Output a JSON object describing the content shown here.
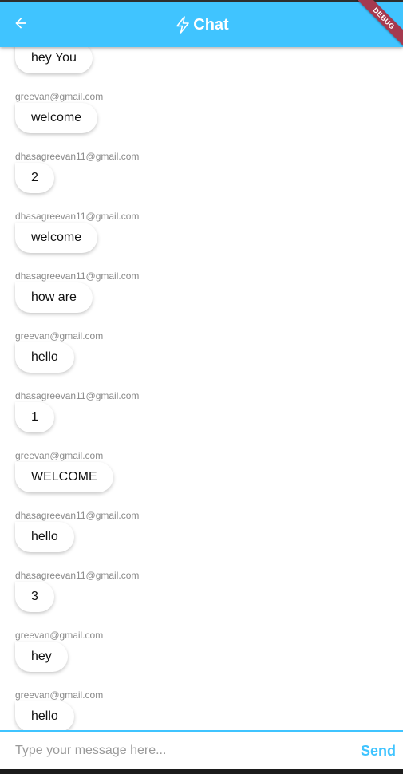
{
  "app_bar": {
    "title": "Chat",
    "back_icon": "arrow-left-icon",
    "title_icon": "lightning-bolt-icon",
    "color": "#40c4ff"
  },
  "debug_banner": "DEBUG",
  "messages": [
    {
      "sender": "",
      "text": "hey You"
    },
    {
      "sender": "greevan@gmail.com",
      "text": "welcome"
    },
    {
      "sender": "dhasagreevan11@gmail.com",
      "text": "2"
    },
    {
      "sender": "dhasagreevan11@gmail.com",
      "text": "welcome"
    },
    {
      "sender": "dhasagreevan11@gmail.com",
      "text": "how are"
    },
    {
      "sender": "greevan@gmail.com",
      "text": "hello"
    },
    {
      "sender": "dhasagreevan11@gmail.com",
      "text": "1"
    },
    {
      "sender": "greevan@gmail.com",
      "text": "WELCOME"
    },
    {
      "sender": "dhasagreevan11@gmail.com",
      "text": "hello"
    },
    {
      "sender": "dhasagreevan11@gmail.com",
      "text": "3"
    },
    {
      "sender": "greevan@gmail.com",
      "text": "hey"
    },
    {
      "sender": "greevan@gmail.com",
      "text": "hello"
    }
  ],
  "composer": {
    "placeholder": "Type your message here...",
    "value": "",
    "send_label": "Send",
    "send_color": "#40c4ff"
  }
}
